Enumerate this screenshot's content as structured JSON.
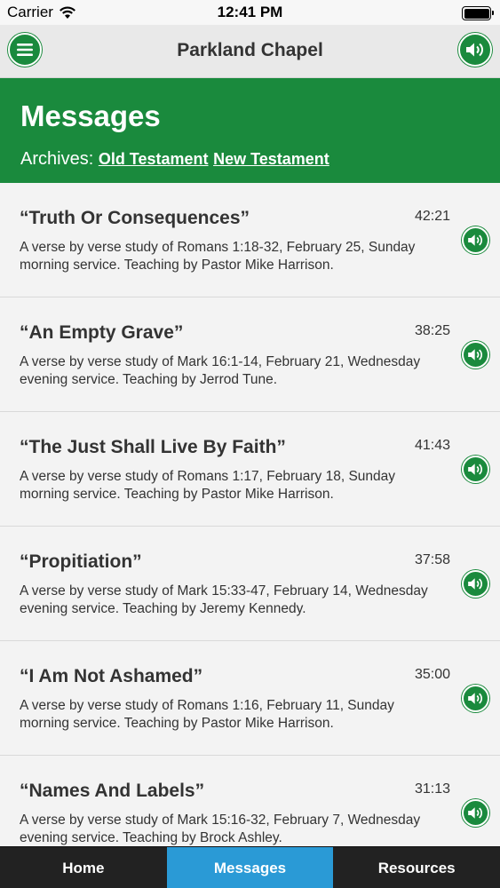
{
  "status": {
    "carrier": "Carrier",
    "time": "12:41 PM"
  },
  "nav": {
    "title": "Parkland Chapel"
  },
  "header": {
    "title": "Messages",
    "archives_label": "Archives:",
    "links": [
      "Old Testament",
      "New Testament"
    ]
  },
  "messages": [
    {
      "title": "“Truth Or Consequences”",
      "duration": "42:21",
      "description": "A verse by verse study of Romans 1:18-32, February 25, Sunday morning service. Teaching by Pastor Mike Harrison."
    },
    {
      "title": "“An Empty Grave”",
      "duration": "38:25",
      "description": "A verse by verse study of Mark 16:1-14, February 21, Wednesday evening service. Teaching by Jerrod Tune."
    },
    {
      "title": "“The Just Shall Live By Faith”",
      "duration": "41:43",
      "description": "A verse by verse study of Romans 1:17, February 18, Sunday morning service. Teaching by Pastor Mike Harrison."
    },
    {
      "title": "“Propitiation”",
      "duration": "37:58",
      "description": "A verse by verse study of Mark 15:33-47, February 14, Wednesday evening service. Teaching by Jeremy Kennedy."
    },
    {
      "title": "“I Am Not Ashamed”",
      "duration": "35:00",
      "description": "A verse by verse study of Romans 1:16, February 11, Sunday morning service. Teaching by Pastor Mike Harrison."
    },
    {
      "title": "“Names And Labels”",
      "duration": "31:13",
      "description": "A verse by verse study of Mark 15:16-32, February 7, Wednesday evening service. Teaching by Brock Ashley."
    }
  ],
  "tabs": [
    "Home",
    "Messages",
    "Resources"
  ],
  "colors": {
    "brand_green": "#1a8a3d",
    "tab_active": "#2a9ad6",
    "tab_bar": "#222222"
  },
  "icons": {
    "menu": "hamburger-icon",
    "audio": "speaker-icon",
    "wifi": "wifi-icon",
    "battery": "battery-icon"
  }
}
